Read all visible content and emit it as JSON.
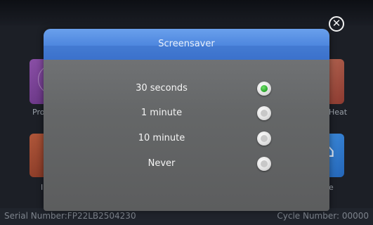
{
  "dialog": {
    "title": "Screensaver",
    "options": [
      {
        "label": "30 seconds",
        "selected": true
      },
      {
        "label": "1 minute",
        "selected": false
      },
      {
        "label": "10 minute",
        "selected": false
      },
      {
        "label": "Never",
        "selected": false
      }
    ]
  },
  "background": {
    "program_label": "Pro",
    "heat_label": "Heat",
    "left_tile_label": "I",
    "home_label": "e"
  },
  "footer": {
    "serial": "Serial Number:FP22LB2504230",
    "cycle": "Cycle Number: 00000"
  },
  "icons": {
    "close": "close-icon",
    "home": "home-icon"
  },
  "colors": {
    "header_blue": "#4d86de",
    "selected_green": "#27a32a"
  }
}
